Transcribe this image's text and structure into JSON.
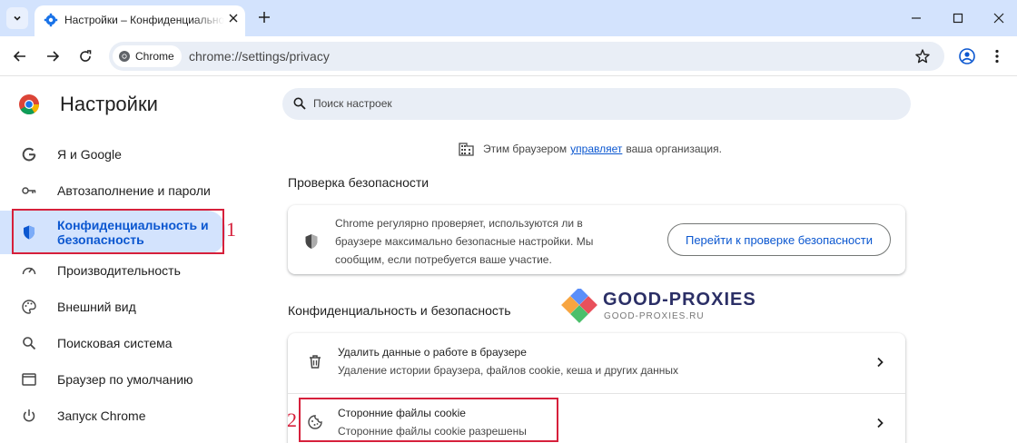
{
  "tab": {
    "title": "Настройки – Конфиденциальность и безопасность"
  },
  "omnibox": {
    "chip_label": "Chrome",
    "url": "chrome://settings/privacy"
  },
  "sidebar": {
    "title": "Настройки",
    "items": [
      {
        "label": "Я и Google",
        "icon": "google-icon"
      },
      {
        "label": "Автозаполнение и пароли",
        "icon": "key-icon"
      },
      {
        "label": "Конфиденциальность и безопасность",
        "icon": "shield-icon",
        "active": true
      },
      {
        "label": "Производительность",
        "icon": "speedometer-icon"
      },
      {
        "label": "Внешний вид",
        "icon": "palette-icon"
      },
      {
        "label": "Поисковая система",
        "icon": "search-icon"
      },
      {
        "label": "Браузер по умолчанию",
        "icon": "browser-window-icon"
      },
      {
        "label": "Запуск Chrome",
        "icon": "power-icon"
      }
    ]
  },
  "search": {
    "placeholder": "Поиск настроек"
  },
  "managed": {
    "prefix": "Этим браузером",
    "link": "управляет",
    "suffix": "ваша организация."
  },
  "safety_check": {
    "heading": "Проверка безопасности",
    "text": "Chrome регулярно проверяет, используются ли в браузере максимально безопасные настройки. Мы сообщим, если потребуется ваше участие.",
    "button": "Перейти к проверке безопасности"
  },
  "privacy": {
    "heading": "Конфиденциальность и безопасность",
    "rows": [
      {
        "title": "Удалить данные о работе в браузере",
        "subtitle": "Удаление истории браузера, файлов cookie, кеша и других данных",
        "icon": "trash-icon"
      },
      {
        "title": "Сторонние файлы cookie",
        "subtitle": "Сторонние файлы cookie разрешены",
        "icon": "cookie-icon"
      }
    ]
  },
  "annotations": {
    "one": "1",
    "two": "2"
  },
  "watermark": {
    "title": "GOOD-PROXIES",
    "subtitle": "GOOD-PROXIES.RU"
  },
  "colors": {
    "accent": "#0b57d0",
    "active_bg": "#d3e3fd",
    "annotation_red": "#d6203b"
  }
}
